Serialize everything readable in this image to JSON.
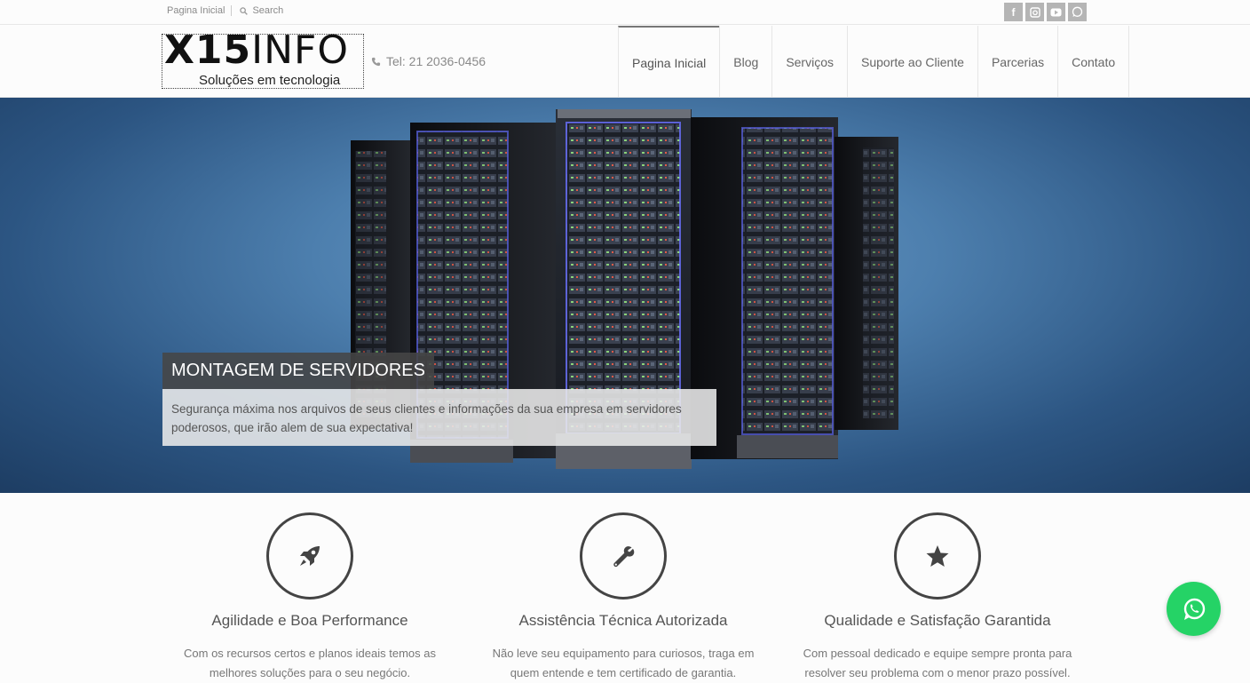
{
  "topbar": {
    "home_link": "Pagina Inicial",
    "search_label": "Search",
    "social": [
      "facebook-icon",
      "instagram-icon",
      "youtube-icon",
      "whatsapp-icon"
    ]
  },
  "header": {
    "logo_main_a": "X15",
    "logo_main_b": "INFO",
    "logo_sub": "Soluções em tecnologia",
    "phone": "Tel: 21 2036-0456",
    "nav": [
      {
        "label": "Pagina Inicial",
        "active": true
      },
      {
        "label": "Blog",
        "active": false
      },
      {
        "label": "Serviços",
        "active": false
      },
      {
        "label": "Suporte ao Cliente",
        "active": false
      },
      {
        "label": "Parcerias",
        "active": false
      },
      {
        "label": "Contato",
        "active": false
      }
    ]
  },
  "hero": {
    "title": "MONTAGEM DE SERVIDORES",
    "text": "Segurança máxima nos arquivos de seus clientes e informações da sua empresa em servidores poderosos, que irão alem de sua expectativa!"
  },
  "features": [
    {
      "icon": "rocket-icon",
      "title": "Agilidade e Boa Performance",
      "text": "Com os recursos certos e planos ideais temos as melhores soluções para o seu negócio."
    },
    {
      "icon": "wrench-icon",
      "title": "Assistência Técnica Autorizada",
      "text": "Não leve seu equipamento para curiosos, traga em quem entende e tem certificado de garantia."
    },
    {
      "icon": "star-icon",
      "title": "Qualidade e Satisfação Garantida",
      "text": "Com pessoal dedicado e equipe sempre pronta para resolver seu problema com o menor prazo possível."
    }
  ],
  "colors": {
    "whatsapp": "#25d366",
    "hero_blue": "#4d7fae"
  }
}
